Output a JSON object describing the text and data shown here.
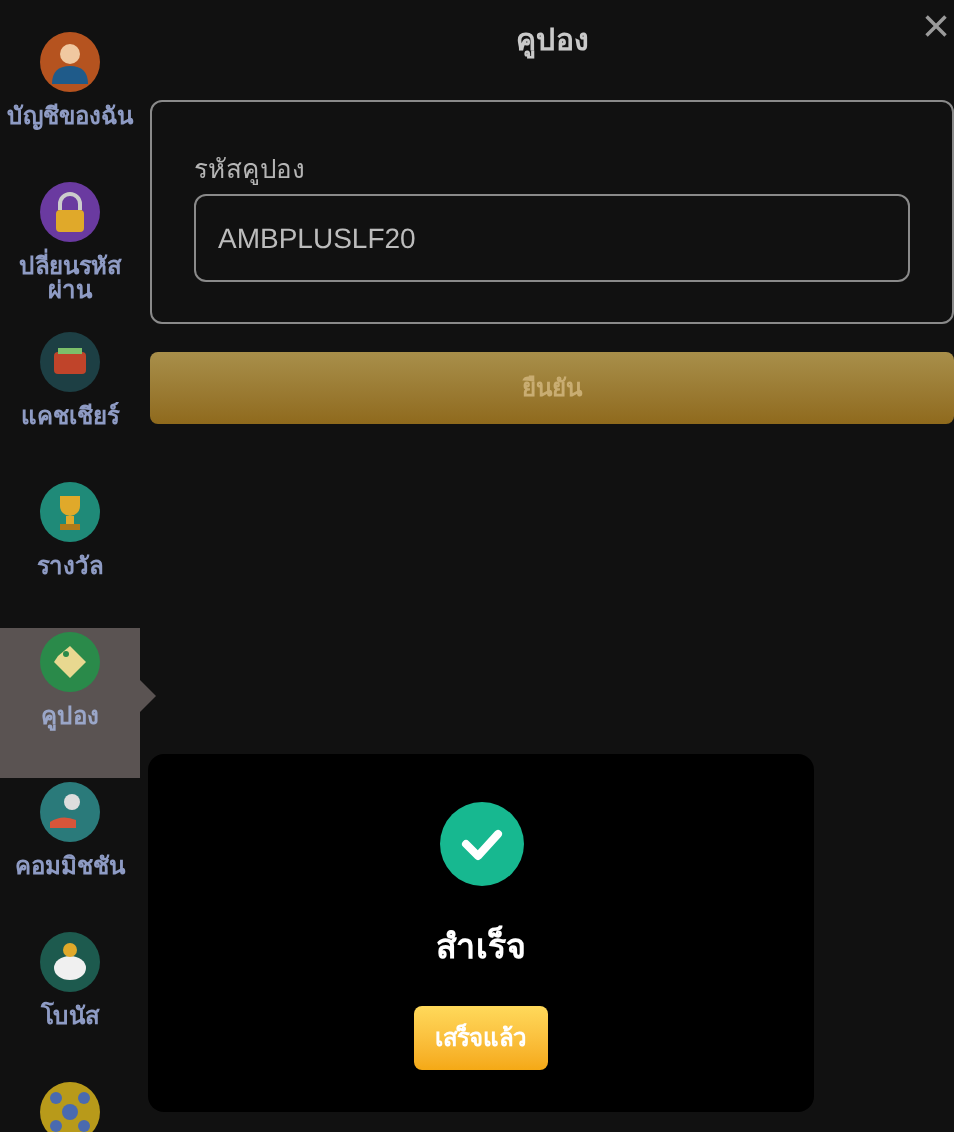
{
  "sidebar": {
    "items": [
      {
        "label": "บัญชีของฉัน",
        "kind": "person",
        "selected": false
      },
      {
        "label": "ปลี่ยนรหัสผ่าน",
        "kind": "lock",
        "selected": false
      },
      {
        "label": "แคชเชียร์",
        "kind": "wallet",
        "selected": false
      },
      {
        "label": "รางวัล",
        "kind": "trophy",
        "selected": false
      },
      {
        "label": "คูปอง",
        "kind": "tag",
        "selected": true
      },
      {
        "label": "คอมมิชชัน",
        "kind": "hand",
        "selected": false
      },
      {
        "label": "โบนัส",
        "kind": "piggy",
        "selected": false
      },
      {
        "kind": "network",
        "selected": false
      }
    ]
  },
  "dialog": {
    "title": "คูปอง",
    "close": "×",
    "field": {
      "label": "รหัสคูปอง",
      "value": "AMBPLUSLF20"
    },
    "submit": "ยืนยัน"
  },
  "alert": {
    "message": "สำเร็จ",
    "button": "เสร็จแล้ว"
  }
}
